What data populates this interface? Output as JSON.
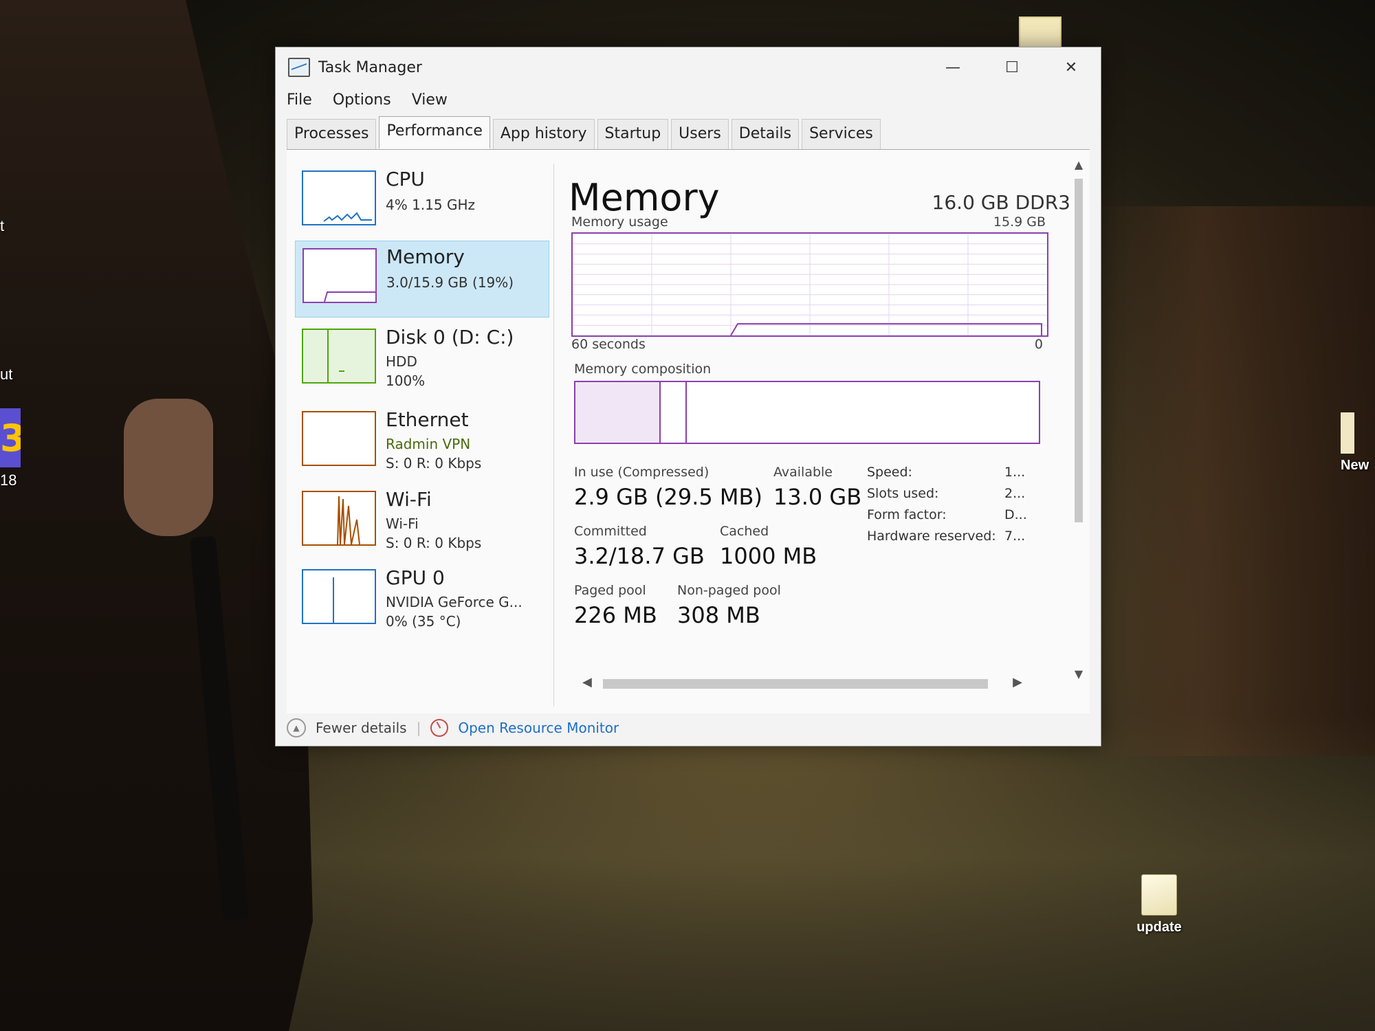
{
  "desktop": {
    "left_edge_texts": [
      "t",
      "ut",
      "18"
    ],
    "left_tile_char": "3",
    "right_icon_label": "New",
    "update_icon_label": "update"
  },
  "window": {
    "title": "Task Manager",
    "controls": {
      "minimize": "—",
      "maximize": "☐",
      "close": "✕"
    }
  },
  "menu": [
    "File",
    "Options",
    "View"
  ],
  "tabs": [
    "Processes",
    "Performance",
    "App history",
    "Startup",
    "Users",
    "Details",
    "Services"
  ],
  "active_tab": "Performance",
  "sidebar": {
    "items": [
      {
        "name": "CPU",
        "sub1": "4% 1.15 GHz",
        "sub2": "",
        "color": "#1e72c6"
      },
      {
        "name": "Memory",
        "sub1": "3.0/15.9 GB (19%)",
        "sub2": "",
        "color": "#8b3fae"
      },
      {
        "name": "Disk 0 (D: C:)",
        "sub1": "HDD",
        "sub2": "100%",
        "color": "#4da60c"
      },
      {
        "name": "Ethernet",
        "sub1": "Radmin VPN",
        "sub2": "S: 0 R: 0 Kbps",
        "color": "#a74f01"
      },
      {
        "name": "Wi-Fi",
        "sub1": "Wi-Fi",
        "sub2": "S: 0 R: 0 Kbps",
        "color": "#a74f01"
      },
      {
        "name": "GPU 0",
        "sub1": "NVIDIA GeForce G...",
        "sub2": "0% (35 °C)",
        "color": "#1e72c6"
      }
    ]
  },
  "memory": {
    "title": "Memory",
    "spec": "16.0 GB DDR3",
    "usage_label": "Memory usage",
    "usage_max": "15.9 GB",
    "time_left": "60 seconds",
    "time_right": "0",
    "usage_level": 0.19,
    "composition_label": "Memory composition",
    "in_use_label": "In use (Compressed)",
    "in_use_value": "2.9 GB (29.5 MB)",
    "available_label": "Available",
    "available_value": "13.0 GB",
    "committed_label": "Committed",
    "committed_value": "3.2/18.7 GB",
    "cached_label": "Cached",
    "cached_value": "1000 MB",
    "paged_label": "Paged pool",
    "paged_value": "226 MB",
    "nonpaged_label": "Non-paged pool",
    "nonpaged_value": "308 MB",
    "specs": [
      {
        "k": "Speed:",
        "v": "1..."
      },
      {
        "k": "Slots used:",
        "v": "2..."
      },
      {
        "k": "Form factor:",
        "v": "D..."
      },
      {
        "k": "Hardware reserved:",
        "v": "7..."
      }
    ]
  },
  "footer": {
    "fewer_details": "Fewer details",
    "open_resource_monitor": "Open Resource Monitor"
  }
}
